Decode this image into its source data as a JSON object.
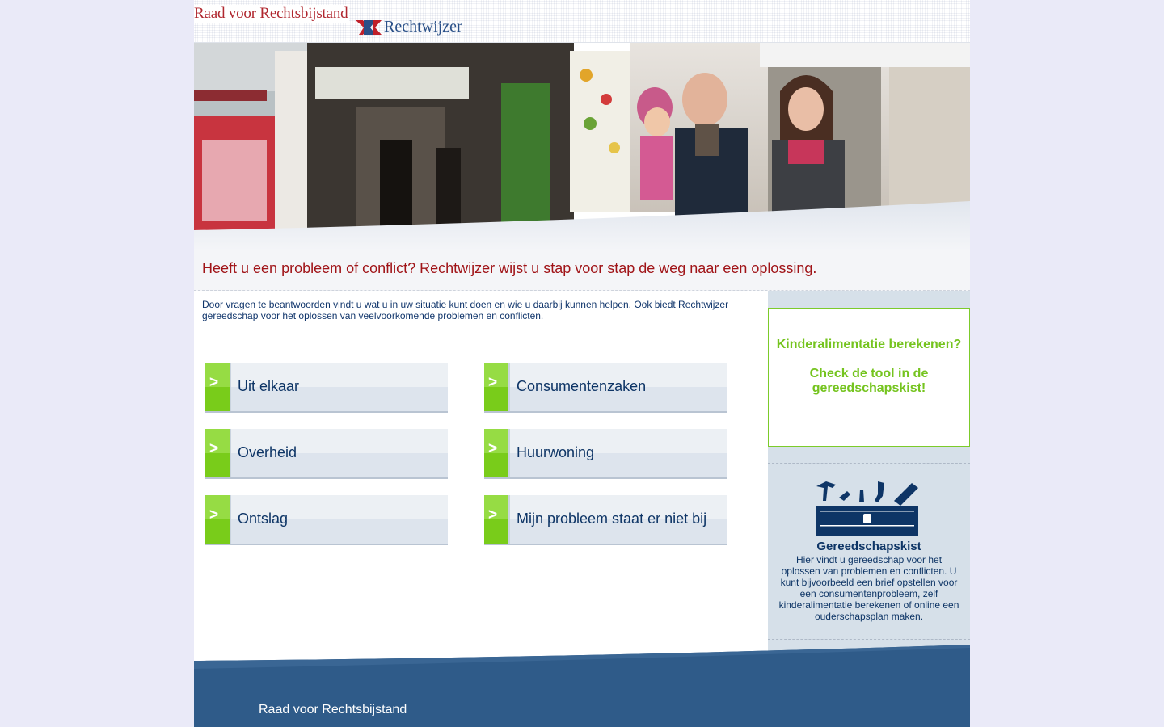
{
  "header": {
    "logo_rvr": "Raad voor Rechtsbijstand",
    "logo_rw": "Rechtwijzer"
  },
  "hero": {
    "image": "photo-family-in-front-of-shop"
  },
  "headline": "Heeft u een probleem of conflict? Rechtwijzer wijst u stap voor stap de weg naar een oplossing.",
  "intro": "Door vragen te beantwoorden vindt u wat u in uw situatie kunt doen en wie u daarbij kunnen helpen. Ook biedt Rechtwijzer gereedschap voor het oplossen van veelvoorkomende problemen en conflicten.",
  "tiles": [
    {
      "arrow": ">",
      "label": "Uit elkaar"
    },
    {
      "arrow": ">",
      "label": "Consumentenzaken"
    },
    {
      "arrow": ">",
      "label": "Overheid"
    },
    {
      "arrow": ">",
      "label": "Huurwoning"
    },
    {
      "arrow": ">",
      "label": "Ontslag"
    },
    {
      "arrow": ">",
      "label": "Mijn probleem staat er niet bij"
    }
  ],
  "promo": {
    "line1": "Kinderalimentatie berekenen?",
    "line2": "Check de tool in de gereedschapskist!"
  },
  "toolbox": {
    "icon": "toolbox-icon",
    "title": "Gereedschapskist",
    "text": "Hier vindt u gereedschap voor het oplossen van problemen en conflicten. U kunt bijvoorbeeld een brief opstellen voor een consumentenprobleem, zelf kinderalimentatie berekenen of online een ouderschapsplan maken."
  },
  "footer": {
    "text": "Raad voor Rechtsbijstand"
  },
  "colors": {
    "background": "#eaeaf8",
    "headline_red": "#a01418",
    "navy": "#0e3566",
    "green": "#79cc1a",
    "footer_blue": "#2f5b89"
  }
}
